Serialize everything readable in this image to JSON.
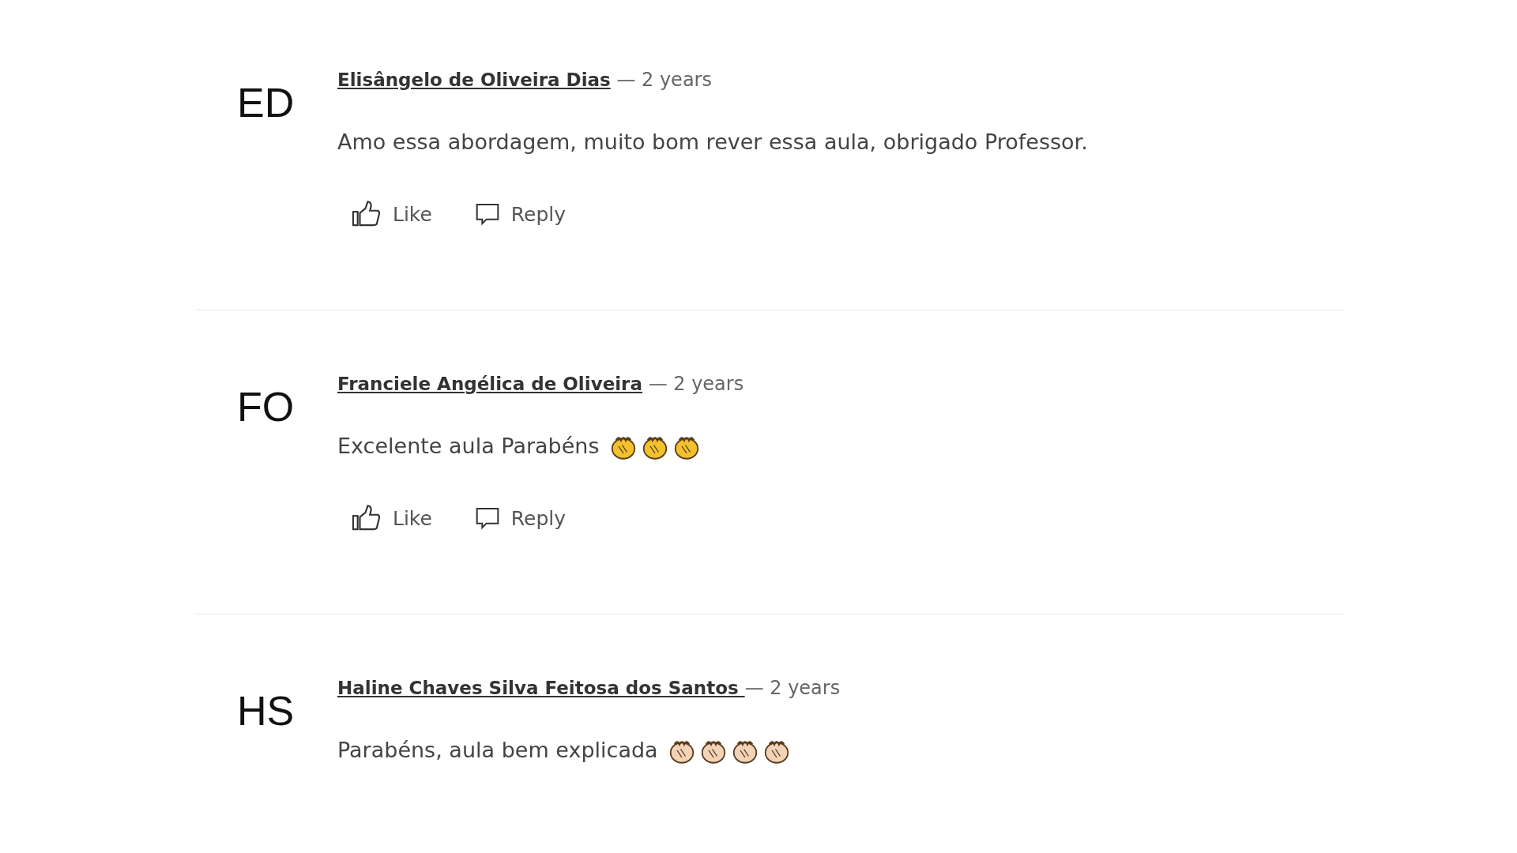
{
  "comments": [
    {
      "initials": "ED",
      "author": "Elisângelo de Oliveira Dias",
      "time": "— 2 years",
      "text": "Amo essa abordagem, muito bom rever essa aula, obrigado Professor.",
      "actions": [
        "Like",
        "Reply"
      ]
    },
    {
      "initials": "FO",
      "author": "Franciele Angélica de Oliveira",
      "time": "— 2 years",
      "text": "Excelente aula Parabéns",
      "emojis": [
        {
          "color": "#f2c12e"
        },
        {
          "color": "#f2c12e"
        },
        {
          "color": "#f2c12e"
        }
      ],
      "actions": [
        "Like",
        "Reply"
      ]
    },
    {
      "initials": "HS",
      "author": "Haline Chaves Silva Feitosa dos Santos ",
      "time": "— 2 years",
      "text": "Parabéns, aula bem explicada",
      "emojis": [
        {
          "color": "#f3d3b8"
        },
        {
          "color": "#f3d3b8"
        },
        {
          "color": "#f3d3b8"
        },
        {
          "color": "#f3d3b8"
        }
      ]
    }
  ]
}
